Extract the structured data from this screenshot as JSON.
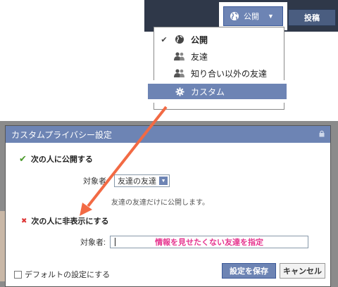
{
  "toolbar": {
    "privacy_label": "公開",
    "post_label": "投稿"
  },
  "dropdown": {
    "items": [
      {
        "label": "公開",
        "checked": true,
        "icon": "globe-icon"
      },
      {
        "label": "友達",
        "checked": false,
        "icon": "friends-icon"
      },
      {
        "label": "知り合い以外の友達",
        "checked": false,
        "icon": "friends-icon"
      },
      {
        "label": "カスタム",
        "checked": false,
        "icon": "gear-icon",
        "highlighted": true
      }
    ]
  },
  "dialog": {
    "title": "カスタムプライバシー設定",
    "show_to": {
      "heading": "次の人に公開する",
      "target_label": "対象者:",
      "target_value": "友達の友達",
      "note": "友達の友達だけに公開します。"
    },
    "hide_from": {
      "heading": "次の人に非表示にする",
      "target_label": "対象者:",
      "input_hint": "情報を見せたくない友達を指定"
    },
    "footer": {
      "default_label": "デフォルトの設定にする",
      "save_label": "設定を保存",
      "cancel_label": "キャンセル"
    }
  },
  "colors": {
    "brand": "#6d84b4",
    "highlight_text": "#e6358f",
    "arrow": "#f26a44"
  }
}
